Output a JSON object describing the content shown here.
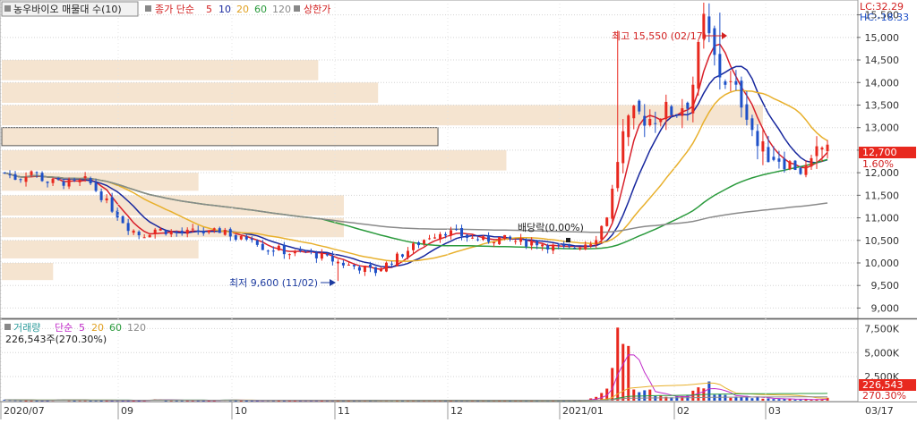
{
  "legend": {
    "title": "농우바이오 매물대 수(10)",
    "close_ma": "종가 단순",
    "ma5": "5",
    "ma10": "10",
    "ma20": "20",
    "ma60": "60",
    "ma120": "120",
    "limit_up": "상한가"
  },
  "info": {
    "lc": "LC:32.29",
    "hc": "HC:-18.33"
  },
  "price_tag": {
    "value": "12,700",
    "change": "1.60%"
  },
  "volume_legend": {
    "title": "거래량",
    "ma_label": "단순",
    "ma5": "5",
    "ma20": "20",
    "ma60": "60",
    "ma120": "120",
    "volume_text": "226,543주(270.30%)"
  },
  "volume_tag": {
    "value": "226,543",
    "change": "270.30%"
  },
  "annotations": {
    "high": "최고 15,550 (02/17)",
    "low": "최저 9,600 (11/02)",
    "dividend": "배당락(0.00%)"
  },
  "colors": {
    "up": "#e8281e",
    "down": "#1e50c8",
    "ma5": "#d8202a",
    "ma10": "#18289e",
    "ma20": "#e8b02c",
    "ma60": "#2a9a3c",
    "ma120": "#8a8a8a",
    "volume_ma5": "#c02ac8",
    "profile": "#f5e4d0"
  },
  "chart_data": {
    "type": "candlestick",
    "y_ticks": [
      "15,500",
      "15,000",
      "14,500",
      "14,000",
      "13,500",
      "13,000",
      "12,500",
      "12,000",
      "11,500",
      "11,000",
      "10,500",
      "10,000",
      "9,500",
      "9,000"
    ],
    "ylim": [
      8850,
      15750
    ],
    "x_labels": [
      "2020/07",
      "09",
      "10",
      "11",
      "12",
      "2021/01",
      "02",
      "03",
      "03/17"
    ],
    "volume_ticks": [
      "7,500K",
      "5,000K",
      "2,500K"
    ],
    "volume_ylim": [
      0,
      8000000
    ],
    "volume_profile_bands": [
      {
        "from": 14050,
        "to": 14500,
        "level": 0.37
      },
      {
        "from": 13550,
        "to": 14000,
        "level": 0.44
      },
      {
        "from": 13050,
        "to": 13500,
        "level": 0.89
      },
      {
        "from": 12600,
        "to": 13000,
        "level": 0.51,
        "highlight": true
      },
      {
        "from": 12050,
        "to": 12500,
        "level": 0.59
      },
      {
        "from": 11600,
        "to": 12000,
        "level": 0.23
      },
      {
        "from": 11050,
        "to": 11500,
        "level": 0.4
      },
      {
        "from": 10570,
        "to": 11000,
        "level": 0.4
      },
      {
        "from": 10100,
        "to": 10500,
        "level": 0.23
      },
      {
        "from": 9620,
        "to": 10000,
        "level": 0.06
      }
    ],
    "series": {
      "close_anchors": [
        12000,
        11850,
        12050,
        11800,
        11800,
        11750,
        11850,
        11500,
        11150,
        10800,
        10600,
        10750,
        10700,
        10650,
        10700,
        10650,
        10750,
        10500,
        10600,
        10300,
        10300,
        10200,
        10250,
        10150,
        10050,
        9950,
        9900,
        9800,
        10000,
        10200,
        10400,
        10600,
        10700,
        10650,
        10550,
        10500,
        10550,
        10500,
        10450,
        10450,
        10350,
        10300,
        10400,
        10500,
        11100,
        12750,
        13300,
        13200,
        13350,
        13400,
        13650,
        15400,
        14250,
        13900,
        13500,
        12500,
        12400,
        12300,
        12000,
        12300,
        12700
      ],
      "volume_anchors": [
        100000,
        60000,
        40000,
        30000,
        120000,
        40000,
        50000,
        30000,
        40000,
        30000,
        20000,
        120000,
        40000,
        30000,
        30000,
        20000,
        80000,
        30000,
        20000,
        60000,
        20000,
        20000,
        30000,
        20000,
        20000,
        30000,
        20000,
        40000,
        60000,
        40000,
        30000,
        30000,
        30000,
        20000,
        30000,
        20000,
        20000,
        20000,
        20000,
        30000,
        20000,
        30000,
        40000,
        300000,
        1200000,
        7500000,
        600000,
        1000000,
        500000,
        300000,
        900000,
        1900000,
        700000,
        400000,
        400000,
        300000,
        200000,
        200000,
        100000,
        150000,
        226543
      ]
    }
  }
}
